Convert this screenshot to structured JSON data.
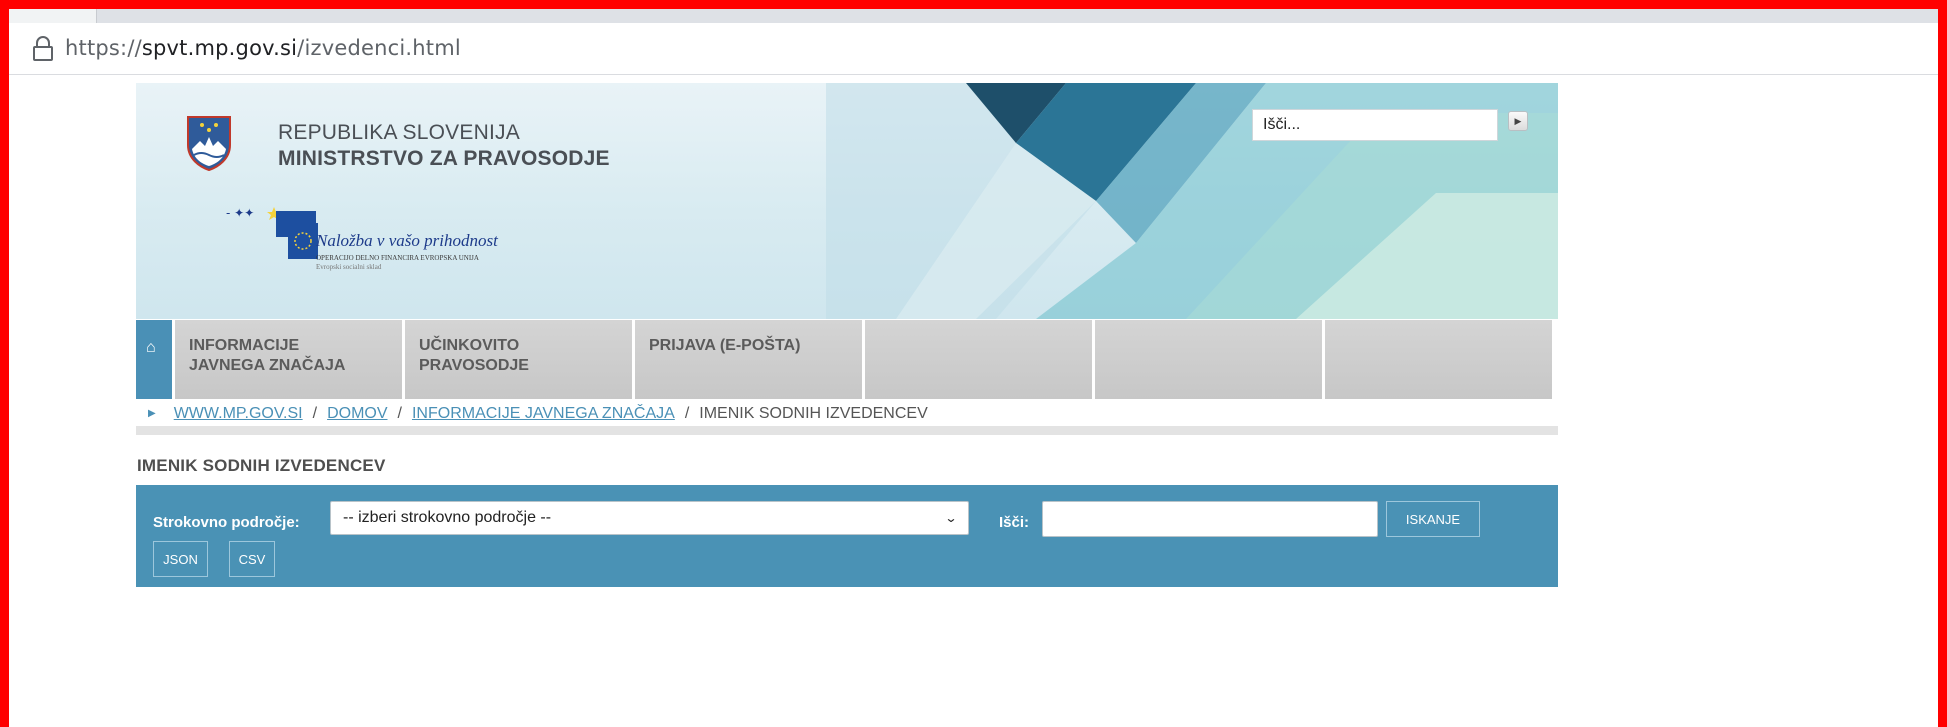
{
  "browser": {
    "url_scheme": "https://",
    "url_host": "spvt.mp.gov.si",
    "url_path": "/izvedenci.html"
  },
  "header": {
    "republic": "REPUBLIKA SLOVENIJA",
    "ministry": "MINISTRSTVO ZA PRAVOSODJE",
    "eu_slogan": "Naložba v vašo prihodnost",
    "eu_line1": "OPERACIJO DELNO FINANCIRA EVROPSKA UNIJA",
    "eu_line2": "Evropski socialni sklad",
    "search_placeholder": "Išči..."
  },
  "nav": {
    "items": [
      {
        "label": "INFORMACIJE\nJAVNEGA ZNAČAJA"
      },
      {
        "label": "UČINKOVITO\nPRAVOSODJE"
      },
      {
        "label": "PRIJAVA (E-POŠTA)"
      },
      {
        "label": ""
      },
      {
        "label": ""
      },
      {
        "label": ""
      }
    ]
  },
  "breadcrumb": {
    "items": [
      "WWW.MP.GOV.SI",
      "DOMOV",
      "INFORMACIJE JAVNEGA ZNAČAJA"
    ],
    "current": "IMENIK SODNIH IZVEDENCEV",
    "separator": "/"
  },
  "page": {
    "title": "IMENIK SODNIH IZVEDENCEV"
  },
  "filters": {
    "area_label": "Strokovno področje:",
    "area_selected": "-- izberi strokovno področje --",
    "search_label": "Išči:",
    "search_value": "",
    "search_button": "ISKANJE",
    "json_button": "JSON",
    "csv_button": "CSV"
  },
  "colors": {
    "accent": "#4a92b5",
    "frame": "#ff0000",
    "nav_bg": "#cccccc"
  }
}
